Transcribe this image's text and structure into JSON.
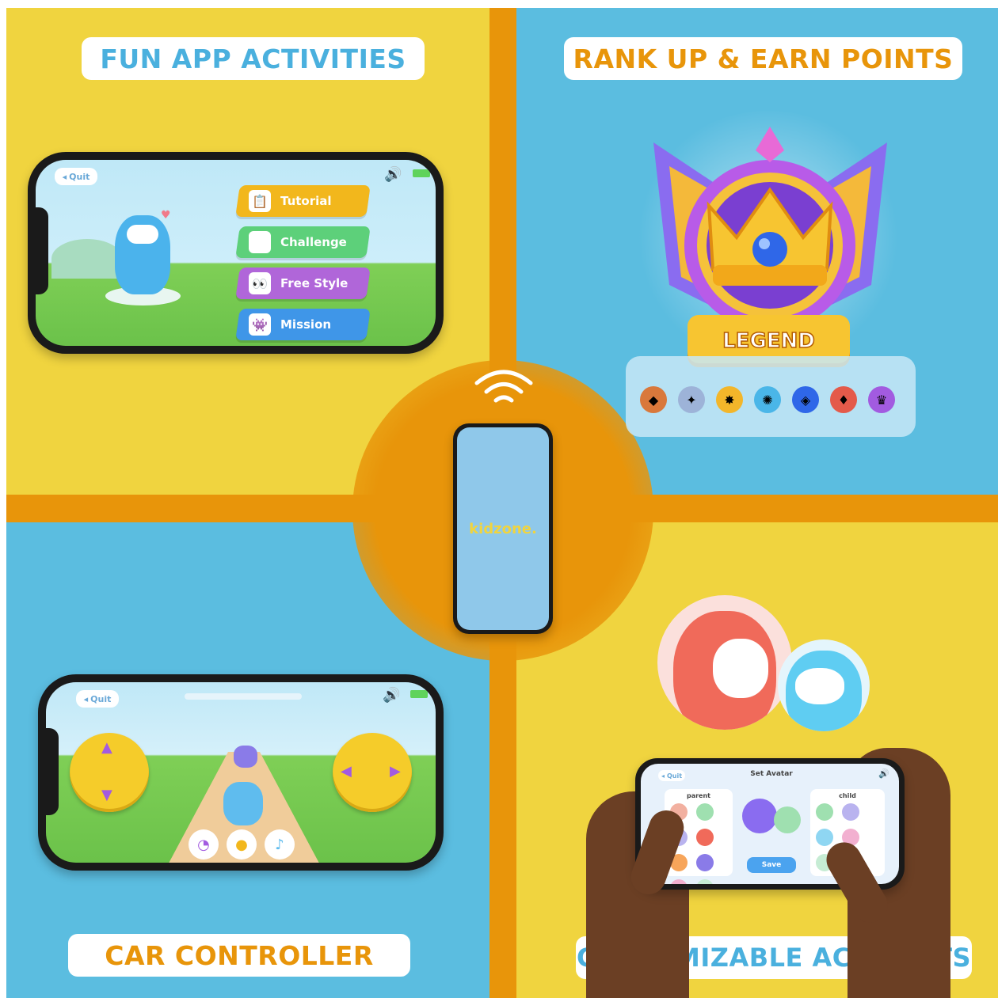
{
  "titles": {
    "top_left": "FUN APP ACTIVITIES",
    "top_right": "RANK UP & EARN POINTS",
    "bottom_left": "CAR CONTROLLER",
    "bottom_right": "CUSTOMIZABLE ACCOUNTS"
  },
  "colors": {
    "yellow_bg": "#f0d43f",
    "blue_bg": "#5bbde0",
    "orange_bar": "#e8950a",
    "title_blue": "#4ab0de",
    "title_orange": "#e8950a"
  },
  "activities_phone": {
    "quit_label": "Quit",
    "menu": [
      {
        "label": "Tutorial",
        "color": "#f2b71c",
        "icon": "clipboard-icon"
      },
      {
        "label": "Challenge",
        "color": "#5dd07a",
        "icon": "map-icon"
      },
      {
        "label": "Free Style",
        "color": "#b066d9",
        "icon": "eyes-icon"
      },
      {
        "label": "Mission",
        "color": "#3f96e8",
        "icon": "monster-icon"
      }
    ]
  },
  "rank": {
    "badge_label": "LEGEND",
    "tier_icons": [
      "bronze-badge-icon",
      "silver-badge-icon",
      "gold-badge-icon",
      "platinum-badge-icon",
      "diamond-badge-icon",
      "master-badge-icon",
      "legend-badge-icon"
    ]
  },
  "center_phone": {
    "brand": "kidzone."
  },
  "controller_phone": {
    "quit_label": "Quit",
    "bottom_buttons": [
      "speed-icon",
      "horn-icon",
      "music-icon"
    ]
  },
  "accounts_phone": {
    "quit_label": "Quit",
    "screen_title": "Set Avatar",
    "parent_label": "parent",
    "child_label": "child",
    "save_label": "Save"
  }
}
